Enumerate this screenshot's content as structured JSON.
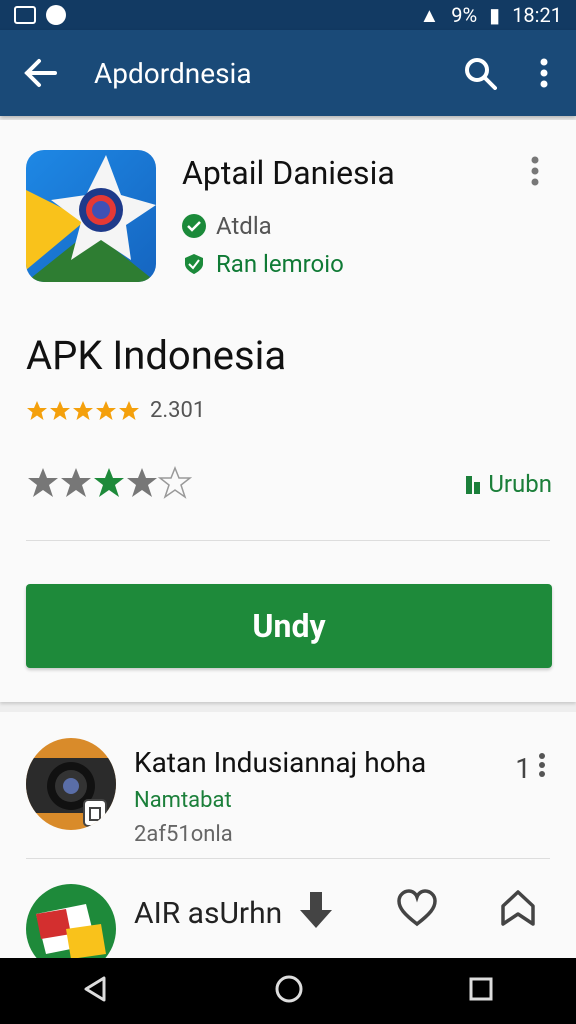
{
  "status": {
    "battery_percent_label": "9%",
    "time": "18:21"
  },
  "appbar": {
    "title": "Apdordnesia"
  },
  "app": {
    "name": "Aptail Daniesia",
    "developer": "Atdla",
    "category": "Ran lemroio",
    "headline": "APK Indonesia",
    "rating_count": "2.301",
    "rating_stars": 5,
    "user_rating": 4,
    "update_label": "Urubn",
    "install_button": "Undy"
  },
  "list": {
    "items": [
      {
        "title": "Katan Indusiannaj hoha",
        "subtitle": "Namtabat",
        "meta": "2af51onla",
        "badge": "1"
      },
      {
        "title": "AIR asUrhn"
      }
    ]
  },
  "colors": {
    "appbar": "#1a4a78",
    "status": "#123a63",
    "accent": "#1e8a3a",
    "star": "#f4a00c"
  },
  "icons": {
    "back": "arrow-left-icon",
    "search": "search-icon",
    "more": "more-vert-icon",
    "verified": "check-badge-icon",
    "shield": "shield-icon",
    "download": "download-icon",
    "heart": "heart-icon",
    "bookmark": "bookmark-icon"
  }
}
